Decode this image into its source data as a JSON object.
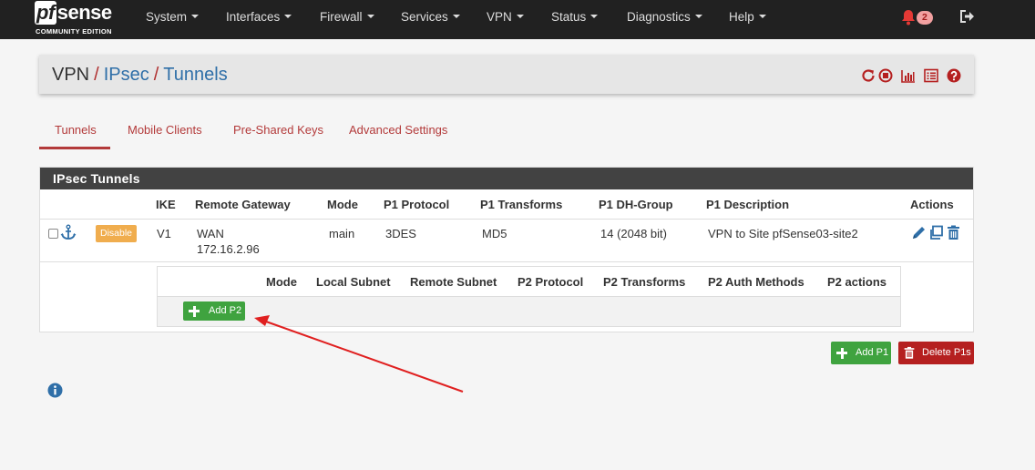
{
  "navbar": {
    "logo_word": "sense",
    "logo_pf": "pf",
    "logo_sub": "COMMUNITY EDITION",
    "items": [
      "System",
      "Interfaces",
      "Firewall",
      "Services",
      "VPN",
      "Status",
      "Diagnostics",
      "Help"
    ],
    "notification_count": "2"
  },
  "breadcrumb": {
    "root": "VPN",
    "section": "IPsec",
    "page": "Tunnels"
  },
  "tabs": [
    "Tunnels",
    "Mobile Clients",
    "Pre-Shared Keys",
    "Advanced Settings"
  ],
  "panel": {
    "title": "IPsec Tunnels",
    "columns": [
      "IKE",
      "Remote Gateway",
      "Mode",
      "P1 Protocol",
      "P1 Transforms",
      "P1 DH-Group",
      "P1 Description",
      "Actions"
    ],
    "row": {
      "disable_label": "Disable",
      "ike": "V1",
      "gateway_iface": "WAN",
      "gateway_ip": "172.16.2.96",
      "mode": "main",
      "protocol": "3DES",
      "transforms": "MD5",
      "dh_group": "14 (2048 bit)",
      "description": "VPN to Site pfSense03-site2"
    },
    "p2_columns": [
      "Mode",
      "Local Subnet",
      "Remote Subnet",
      "P2 Protocol",
      "P2 Transforms",
      "P2 Auth Methods",
      "P2 actions"
    ],
    "add_p2_label": "Add P2"
  },
  "buttons": {
    "add_p1": "Add P1",
    "delete_p1s": "Delete P1s"
  },
  "colors": {
    "accent_red": "#b33a3a",
    "link_blue": "#2f6fa8",
    "green": "#3fa33f",
    "orange": "#f0ad4e",
    "annotation_arrow": "#e02020"
  }
}
